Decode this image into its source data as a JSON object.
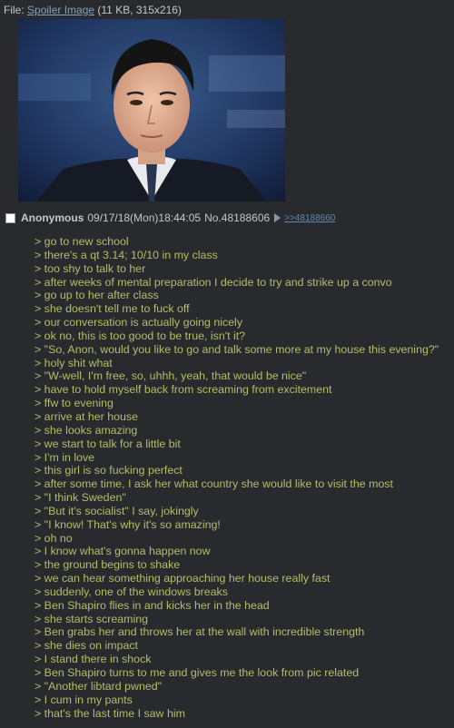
{
  "file": {
    "prefix": "File:",
    "name": "Spoiler Image",
    "meta": "(11 KB, 315x216)"
  },
  "post": {
    "name": "Anonymous",
    "datetime": "09/17/18(Mon)18:44:05",
    "number": "No.48188606",
    "backlink": ">>48188660"
  },
  "lines": [
    "> go to new school",
    "> there's a qt 3.14; 10/10 in my class",
    "> too shy to talk to her",
    "> after weeks of mental preparation I decide to try and strike up a convo",
    "> go up to her after class",
    "> she doesn't tell me to fuck off",
    "> our conversation is actually going nicely",
    "> ok no, this is too good to be true, isn't it?",
    "> \"So, Anon, would you like to go and talk some more at my house this evening?\"",
    "> holy shit what",
    "> \"W-well, I'm free, so, uhhh, yeah, that would be nice\"",
    "> have to hold myself back from screaming from excitement",
    "> ffw to evening",
    "> arrive at her house",
    "> she looks amazing",
    "> we start to talk for a little bit",
    "> I'm in love",
    "> this girl is so fucking perfect",
    "> after some time, I ask her what country she would like to visit the most",
    "> \"I think Sweden\"",
    "> \"But it's socialist\" I say, jokingly",
    "> \"I know! That's why it's so amazing!",
    "> oh no",
    "> I know what's gonna happen now",
    "> the ground begins to shake",
    "> we can hear something approaching her house really fast",
    "> suddenly, one of the windows breaks",
    "> Ben Shapiro flies in and kicks her in the head",
    "> she starts screaming",
    "> Ben grabs her and throws her at the wall with incredible strength",
    "> she dies on impact",
    "> I stand there in shock",
    "> Ben Shapiro turns to me and gives me the look from pic related",
    "> \"Another libtard pwned\"",
    "> I cum in my pants",
    "> that's the last time I saw him"
  ]
}
